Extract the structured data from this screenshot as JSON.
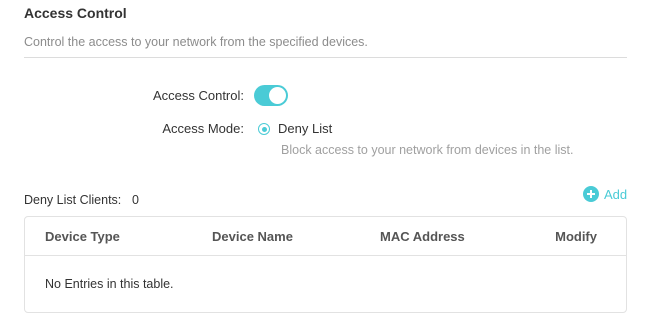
{
  "section": {
    "title": "Access Control",
    "description": "Control the access to your network from the specified devices."
  },
  "access_control": {
    "label": "Access Control:",
    "enabled": true
  },
  "access_mode": {
    "label": "Access Mode:",
    "selected_option": "Deny List",
    "description": "Block access to your network from devices in the list."
  },
  "clients": {
    "label": "Deny List Clients:",
    "count": "0",
    "add_label": "Add"
  },
  "table": {
    "columns": [
      "Device Type",
      "Device Name",
      "MAC Address",
      "Modify"
    ],
    "empty_message": "No Entries in this table."
  },
  "colors": {
    "accent": "#4acbd6"
  }
}
